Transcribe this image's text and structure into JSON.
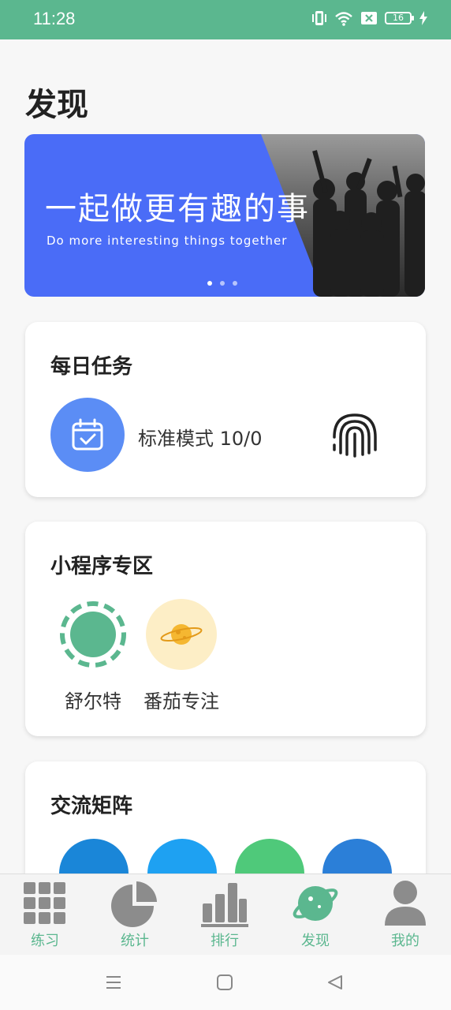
{
  "status_bar": {
    "time": "11:28",
    "battery": "16",
    "icons": [
      "vibrate-icon",
      "wifi-icon",
      "sim-off-icon",
      "battery-icon",
      "charging-icon"
    ]
  },
  "page": {
    "title": "发现"
  },
  "banner": {
    "headline": "一起做更有趣的事",
    "subline": "Do more interesting things together",
    "page_count": 3,
    "active_index": 0
  },
  "daily_task": {
    "title": "每日任务",
    "mode_text": "标准模式 10/0",
    "icon": "calendar-check-icon",
    "action_icon": "fingerprint-icon"
  },
  "mini_programs": {
    "title": "小程序专区",
    "items": [
      {
        "label": "舒尔特",
        "icon": "schulte-icon",
        "color": "#5bb78f"
      },
      {
        "label": "番茄专注",
        "icon": "planet-icon",
        "color": "#fdeec6"
      }
    ]
  },
  "community": {
    "title": "交流矩阵",
    "items": [
      {
        "icon": "weibo-icon",
        "color": "#1a86d8"
      },
      {
        "icon": "qq-icon",
        "color": "#1ea1f2"
      },
      {
        "icon": "wechat-icon",
        "color": "#4fc97a"
      },
      {
        "icon": "baidu-icon",
        "color": "#2b7fd8"
      }
    ]
  },
  "bottom_nav": {
    "items": [
      {
        "label": "练习",
        "icon": "grid-icon"
      },
      {
        "label": "统计",
        "icon": "pie-chart-icon"
      },
      {
        "label": "排行",
        "icon": "bar-chart-icon"
      },
      {
        "label": "发现",
        "icon": "planet-icon",
        "active": true
      },
      {
        "label": "我的",
        "icon": "user-icon"
      }
    ],
    "active_color": "#5bb78f",
    "inactive_color": "#8c8c8c"
  },
  "system_nav": {
    "icons": [
      "menu-icon",
      "home-icon",
      "back-icon"
    ]
  },
  "colors": {
    "accent": "#5bb78f",
    "banner_blue": "#4a6cf7"
  }
}
